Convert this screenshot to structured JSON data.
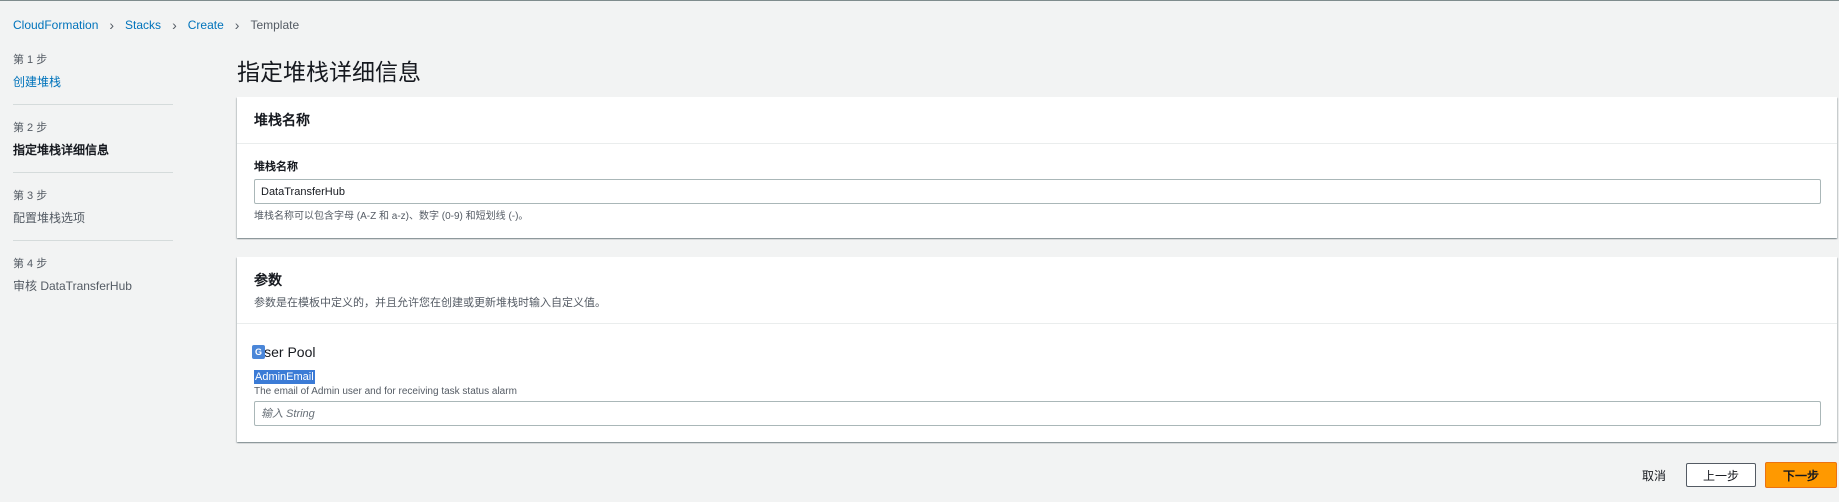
{
  "breadcrumb": {
    "items": [
      "CloudFormation",
      "Stacks",
      "Create"
    ],
    "current": "Template"
  },
  "steps": [
    {
      "num": "第 1 步",
      "label": "创建堆栈"
    },
    {
      "num": "第 2 步",
      "label": "指定堆栈详细信息"
    },
    {
      "num": "第 3 步",
      "label": "配置堆栈选项"
    },
    {
      "num": "第 4 步",
      "label": "审核 DataTransferHub"
    }
  ],
  "page_title": "指定堆栈详细信息",
  "stack_name_panel": {
    "title": "堆栈名称",
    "field_label": "堆栈名称",
    "value": "DataTransferHub",
    "help": "堆栈名称可以包含字母 (A-Z 和 a-z)、数字 (0-9) 和短划线 (-)。"
  },
  "parameters_panel": {
    "title": "参数",
    "desc": "参数是在模板中定义的，并且允许您在创建或更新堆栈时输入自定义值。",
    "group_title": "User Pool",
    "param_name": "AdminEmail",
    "param_desc": "The email of Admin user and for receiving task status alarm",
    "placeholder": "输入 String"
  },
  "footer": {
    "cancel": "取消",
    "previous": "上一步",
    "next": "下一步"
  },
  "colors": {
    "accent": "#ff9900",
    "link": "#0073bb",
    "selection": "#3b7bd6"
  }
}
